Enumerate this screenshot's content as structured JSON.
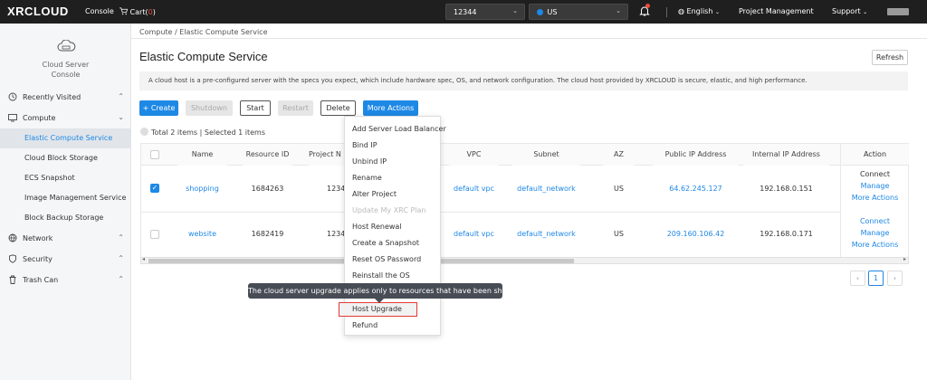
{
  "topbar": {
    "logo": "XRCLOUD",
    "console": "Console",
    "cart_label": "Cart(",
    "cart_count": "0",
    "cart_close": ")",
    "project_select": "12344",
    "region_select": "US",
    "language": "English",
    "project_management": "Project Management",
    "support": "Support"
  },
  "sidebar": {
    "header": [
      "Cloud Server",
      "Console"
    ],
    "groups": [
      {
        "label": "Recently Visited",
        "icon": "clock-icon"
      },
      {
        "label": "Compute",
        "icon": "monitor-icon"
      },
      {
        "label": "Network",
        "icon": "globe-icon"
      },
      {
        "label": "Security",
        "icon": "shield-icon"
      },
      {
        "label": "Trash Can",
        "icon": "trash-icon"
      }
    ],
    "compute_items": [
      {
        "label": "Elastic Compute Service",
        "active": true
      },
      {
        "label": "Cloud Block Storage"
      },
      {
        "label": "ECS Snapshot"
      },
      {
        "label": "Image Management Service"
      },
      {
        "label": "Block Backup Storage"
      }
    ]
  },
  "main": {
    "breadcrumb": "Compute / Elastic Compute Service",
    "title": "Elastic Compute Service",
    "refresh": "Refresh",
    "description": "A cloud host is a pre-configured server with the specs you expect, which include hardware spec, OS, and network configuration. The cloud host provided by XRCLOUD is secure, elastic, and high performance.",
    "buttons": {
      "create": "+ Create",
      "shutdown": "Shutdown",
      "start": "Start",
      "restart": "Restart",
      "delete": "Delete",
      "more_actions": "More Actions"
    },
    "summary": "Total 2 items | Selected 1 items"
  },
  "table": {
    "headers": [
      "Name",
      "Resource ID",
      "Project N",
      "VPC",
      "Subnet",
      "AZ",
      "Public IP Address",
      "Internal IP Address",
      "Action"
    ],
    "rows": [
      {
        "checked": true,
        "name": "shopping",
        "resource_id": "1684263",
        "project": "1234",
        "vpc": "default vpc",
        "subnet": "default_network",
        "az": "US",
        "public_ip": "64.62.245.127",
        "internal_ip": "192.168.0.151",
        "actions": [
          "Connect",
          "Manage",
          "More Actions"
        ]
      },
      {
        "checked": false,
        "name": "website",
        "resource_id": "1682419",
        "project": "1234",
        "vpc": "default vpc",
        "subnet": "default_network",
        "az": "US",
        "public_ip": "209.160.106.42",
        "internal_ip": "192.168.0.171",
        "actions": [
          "Connect",
          "Manage",
          "More Actions"
        ]
      }
    ]
  },
  "pagination": {
    "prev": "‹",
    "current": "1",
    "next": "›"
  },
  "dropdown": {
    "items": [
      {
        "label": "Add Server Load Balancer"
      },
      {
        "label": "Bind IP"
      },
      {
        "label": "Unbind IP"
      },
      {
        "label": "Rename"
      },
      {
        "label": "Alter Project"
      },
      {
        "label": "Update My XRC Plan",
        "disabled": true
      },
      {
        "label": "Host Renewal"
      },
      {
        "label": "Create a Snapshot"
      },
      {
        "label": "Reset OS Password"
      },
      {
        "label": "Reinstall the OS"
      },
      {
        "label": "Host Upgrade",
        "highlighted": true
      },
      {
        "label": "Refund"
      }
    ],
    "tooltip": "The cloud server upgrade applies only to resources that have been shut down"
  },
  "colors": {
    "accent": "#1e88e5",
    "topbar": "#1f1f1f",
    "highlight": "#e53935"
  }
}
